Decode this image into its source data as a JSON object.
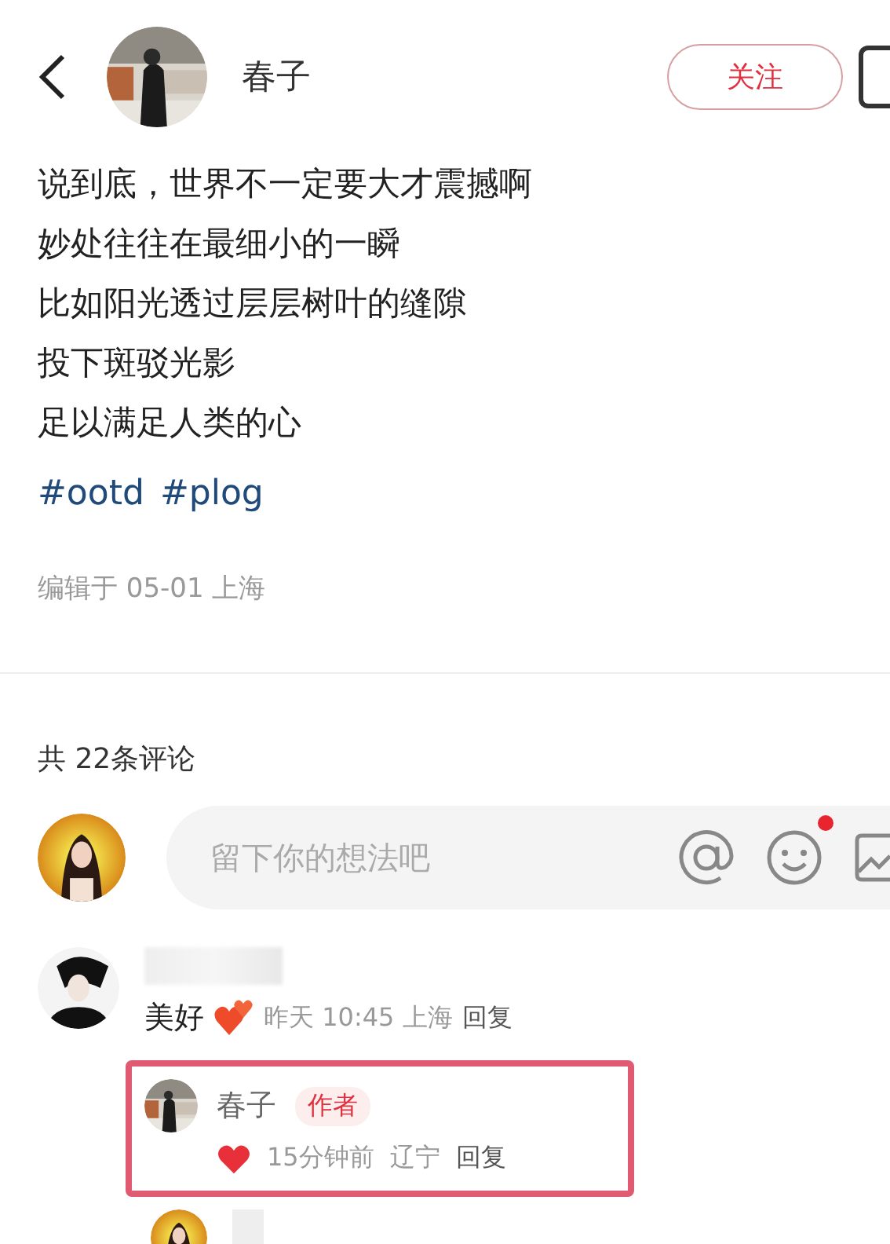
{
  "header": {
    "author": "春子",
    "follow_button": "关注"
  },
  "post": {
    "lines": [
      "说到底，世界不一定要大才震撼啊",
      "妙处往往在最细小的一瞬",
      "比如阳光透过层层树叶的缝隙",
      "投下斑驳光影",
      "足以满足人类的心"
    ],
    "hashtags": [
      "#ootd",
      "#plog"
    ],
    "edit_info": "编辑于 05-01 上海"
  },
  "comment_count": "共 22条评论",
  "comment_input": {
    "placeholder": "留下你的想法吧",
    "emoji_has_new": true
  },
  "comments": [
    {
      "text": "美好",
      "time": "昨天 10:45 上海",
      "reply_label": "回复",
      "replies": [
        {
          "author": "春子",
          "badge": "作者",
          "time": "15分钟前",
          "location": "辽宁",
          "reply_label": "回复",
          "highlighted": true
        }
      ]
    }
  ],
  "more_below": true
}
